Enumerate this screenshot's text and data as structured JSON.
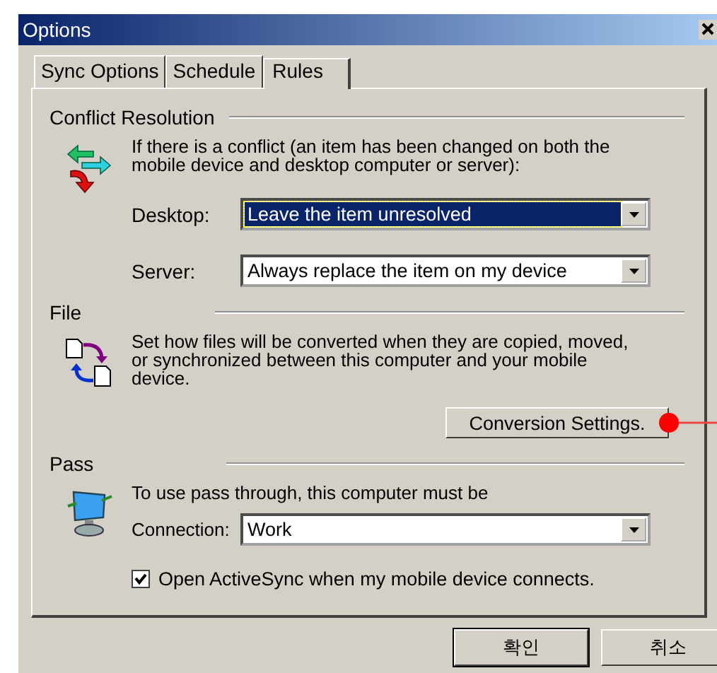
{
  "window": {
    "title": "Options"
  },
  "tabs": [
    {
      "label": "Sync Options",
      "selected": false
    },
    {
      "label": "Schedule",
      "selected": false
    },
    {
      "label": "Rules",
      "selected": true
    }
  ],
  "conflict": {
    "heading": "Conflict Resolution",
    "text": "If there is a conflict (an item has been changed on both the mobile device and desktop computer or server):",
    "fields": [
      {
        "label": "Desktop:",
        "value": "Leave the item unresolved",
        "focused": true
      },
      {
        "label": "Server:",
        "value": "Always replace the item on my device",
        "focused": false
      }
    ]
  },
  "file": {
    "heading": "File",
    "text": "Set how files will be converted when they are copied, moved, or synchronized between this computer and your mobile device.",
    "button": "Conversion Settings."
  },
  "pass": {
    "heading": "Pass",
    "text": "To use pass through, this computer must be",
    "connection": {
      "label": "Connection:",
      "value": "Work"
    },
    "checkbox": {
      "label": "Open ActiveSync when my mobile device connects.",
      "checked": true
    }
  },
  "buttons": [
    {
      "label": "확인",
      "default": true
    },
    {
      "label": "취소",
      "default": false
    }
  ]
}
